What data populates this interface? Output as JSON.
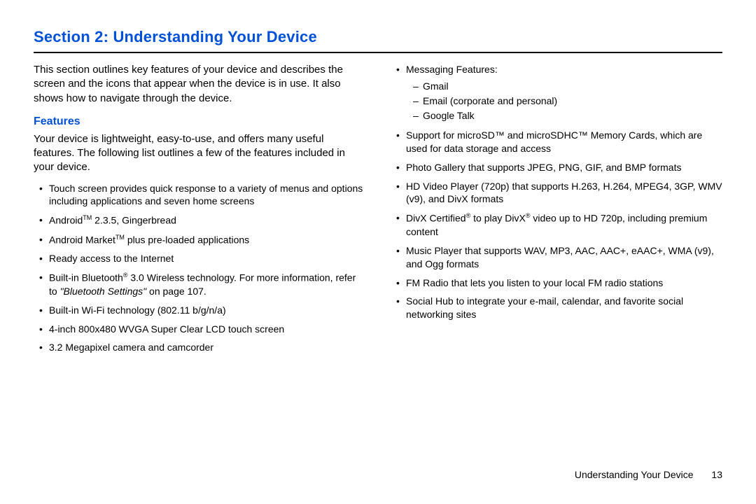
{
  "title": "Section 2: Understanding Your Device",
  "intro": "This section outlines key features of your device and describes the screen and the icons that appear when the device is in use. It also shows how to navigate through the device.",
  "features_heading": "Features",
  "features_intro": "Your device is lightweight, easy-to-use, and offers many useful features. The following list outlines a few of the features included in your device.",
  "left_bullets": {
    "b0": "Touch screen provides quick response to a variety of menus and options including applications and seven home screens",
    "b1_pre": "Android",
    "b1_sup": "TM",
    "b1_post": " 2.3.5, Gingerbread",
    "b2_pre": "Android Market",
    "b2_sup": "TM",
    "b2_post": " plus pre-loaded applications",
    "b3": "Ready access to the Internet",
    "b4_pre": "Built-in Bluetooth",
    "b4_sup": "®",
    "b4_mid": " 3.0 Wireless technology. For more information, refer to ",
    "b4_ital": "\"Bluetooth Settings\"",
    "b4_post": "  on page 107.",
    "b5": "Built-in Wi-Fi technology (802.11 b/g/n/a)",
    "b6": "4-inch 800x480 WVGA Super Clear LCD touch screen",
    "b7": "3.2 Megapixel camera and camcorder"
  },
  "right_bullets": {
    "r0_label": "Messaging Features:",
    "r0_sub": {
      "s0": "Gmail",
      "s1": "Email (corporate and personal)",
      "s2": "Google Talk"
    },
    "r1": "Support for microSD™ and microSDHC™ Memory Cards, which are used for data storage and access",
    "r2": "Photo Gallery that supports JPEG, PNG, GIF, and BMP formats",
    "r3": "HD Video Player (720p) that supports H.263, H.264, MPEG4, 3GP, WMV (v9), and DivX formats",
    "r4_pre": "DivX Certified",
    "r4_sup1": "®",
    "r4_mid": " to play DivX",
    "r4_sup2": "®",
    "r4_post": " video up to HD 720p, including premium content",
    "r5": "Music Player that supports WAV, MP3, AAC, AAC+, eAAC+, WMA (v9), and Ogg formats",
    "r6": "FM Radio that lets you listen to your local FM radio stations",
    "r7": "Social Hub to integrate your e-mail, calendar, and favorite social networking sites"
  },
  "footer": {
    "label": "Understanding Your Device",
    "page": "13"
  }
}
